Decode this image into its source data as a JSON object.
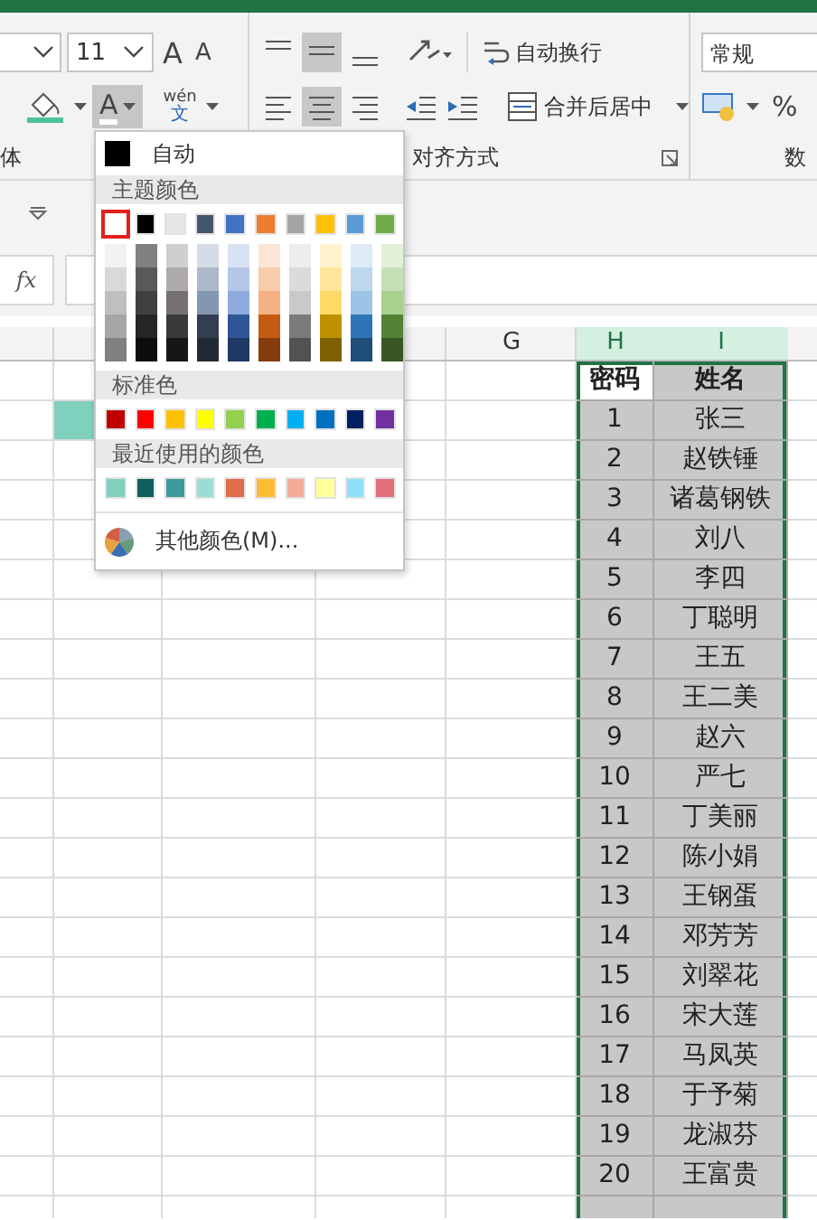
{
  "ribbon": {
    "font_size": "11",
    "grow_font": "A",
    "shrink_font": "A",
    "font_color": {
      "label": "A",
      "pressed": true
    },
    "phonetic": {
      "top": "wén",
      "bottom": "文"
    },
    "wrap_text": "自动换行",
    "merge_center": "合并后居中",
    "number_format": "常规",
    "percent": "%",
    "group_labels": [
      "体",
      "对齐方式",
      "数"
    ]
  },
  "formula_bar": {
    "fx": "fx"
  },
  "color_menu": {
    "auto": "自动",
    "theme_label": "主题颜色",
    "theme": [
      {
        "color": "#ffffff",
        "selected": true,
        "shades": [
          {
            "color": "#f2f2f2",
            "selected": false
          },
          {
            "color": "#d9d9d9",
            "selected": false
          },
          {
            "color": "#bfbfbf",
            "selected": false
          },
          {
            "color": "#a6a6a6",
            "selected": false
          },
          {
            "color": "#808080",
            "selected": false
          }
        ]
      },
      {
        "color": "#000000",
        "selected": false,
        "shades": [
          {
            "color": "#808080",
            "selected": false
          },
          {
            "color": "#595959",
            "selected": false
          },
          {
            "color": "#404040",
            "selected": false
          },
          {
            "color": "#262626",
            "selected": false
          },
          {
            "color": "#0d0d0d",
            "selected": false
          }
        ]
      },
      {
        "color": "#e7e6e6",
        "selected": false,
        "shades": [
          {
            "color": "#d0cece",
            "selected": false
          },
          {
            "color": "#aeaaaa",
            "selected": false
          },
          {
            "color": "#767171",
            "selected": false
          },
          {
            "color": "#3a3838",
            "selected": false
          },
          {
            "color": "#171616",
            "selected": false
          }
        ]
      },
      {
        "color": "#44546a",
        "selected": false,
        "shades": [
          {
            "color": "#d6dce5",
            "selected": false
          },
          {
            "color": "#adb9ca",
            "selected": false
          },
          {
            "color": "#8497b0",
            "selected": false
          },
          {
            "color": "#333f50",
            "selected": false
          },
          {
            "color": "#222a35",
            "selected": false
          }
        ]
      },
      {
        "color": "#4472c4",
        "selected": false,
        "shades": [
          {
            "color": "#dae3f3",
            "selected": false
          },
          {
            "color": "#b4c7e7",
            "selected": false
          },
          {
            "color": "#8faadc",
            "selected": false
          },
          {
            "color": "#2f5597",
            "selected": false
          },
          {
            "color": "#203864",
            "selected": false
          }
        ]
      },
      {
        "color": "#ed7d31",
        "selected": false,
        "shades": [
          {
            "color": "#fbe5d6",
            "selected": false
          },
          {
            "color": "#f8cbad",
            "selected": false
          },
          {
            "color": "#f4b183",
            "selected": false
          },
          {
            "color": "#c55a11",
            "selected": false
          },
          {
            "color": "#843c0c",
            "selected": false
          }
        ]
      },
      {
        "color": "#a5a5a5",
        "selected": false,
        "shades": [
          {
            "color": "#ededed",
            "selected": false
          },
          {
            "color": "#dbdbdb",
            "selected": false
          },
          {
            "color": "#c9c9c9",
            "selected": false
          },
          {
            "color": "#7b7b7b",
            "selected": false
          },
          {
            "color": "#525252",
            "selected": false
          }
        ]
      },
      {
        "color": "#ffc000",
        "selected": false,
        "shades": [
          {
            "color": "#fff2cc",
            "selected": false
          },
          {
            "color": "#ffe699",
            "selected": false
          },
          {
            "color": "#ffd966",
            "selected": false
          },
          {
            "color": "#bf9000",
            "selected": false
          },
          {
            "color": "#7f6000",
            "selected": false
          }
        ]
      },
      {
        "color": "#5b9bd5",
        "selected": false,
        "shades": [
          {
            "color": "#deebf7",
            "selected": false
          },
          {
            "color": "#bdd7ee",
            "selected": false
          },
          {
            "color": "#9dc3e6",
            "selected": false
          },
          {
            "color": "#2e75b6",
            "selected": false
          },
          {
            "color": "#1f4e79",
            "selected": false
          }
        ]
      },
      {
        "color": "#70ad47",
        "selected": false,
        "shades": [
          {
            "color": "#e2f0d9",
            "selected": false
          },
          {
            "color": "#c5e0b4",
            "selected": false
          },
          {
            "color": "#a9d18e",
            "selected": false
          },
          {
            "color": "#548235",
            "selected": false
          },
          {
            "color": "#385723",
            "selected": false
          }
        ]
      }
    ],
    "standard_label": "标准色",
    "standard": [
      {
        "color": "#c00000",
        "selected": false
      },
      {
        "color": "#ff0000",
        "selected": false
      },
      {
        "color": "#ffc000",
        "selected": false
      },
      {
        "color": "#ffff00",
        "selected": false
      },
      {
        "color": "#92d050",
        "selected": false
      },
      {
        "color": "#00b050",
        "selected": false
      },
      {
        "color": "#00b0f0",
        "selected": false
      },
      {
        "color": "#0070c0",
        "selected": false
      },
      {
        "color": "#002060",
        "selected": false
      },
      {
        "color": "#7030a0",
        "selected": false
      }
    ],
    "recent_label": "最近使用的颜色",
    "recent": [
      {
        "color": "#7fd0bd",
        "selected": false
      },
      {
        "color": "#0f5f5f",
        "selected": false
      },
      {
        "color": "#3b9b9b",
        "selected": false
      },
      {
        "color": "#9addd8",
        "selected": false
      },
      {
        "color": "#e06c4c",
        "selected": false
      },
      {
        "color": "#ffba33",
        "selected": false
      },
      {
        "color": "#f4aa99",
        "selected": false
      },
      {
        "color": "#ffff99",
        "selected": false
      },
      {
        "color": "#8de0fb",
        "selected": false
      },
      {
        "color": "#e3707a",
        "selected": false
      }
    ],
    "more": "其他颜色(M)..."
  },
  "sheet": {
    "columns": [
      {
        "label": "G",
        "selected": false
      },
      {
        "label": "H",
        "selected": true
      },
      {
        "label": "I",
        "selected": true
      }
    ],
    "table": {
      "header": [
        "密码",
        "姓名"
      ],
      "rows": [
        [
          "1",
          "张三"
        ],
        [
          "2",
          "赵铁锤"
        ],
        [
          "3",
          "诸葛钢铁"
        ],
        [
          "4",
          "刘八"
        ],
        [
          "5",
          "李四"
        ],
        [
          "6",
          "丁聪明"
        ],
        [
          "7",
          "王五"
        ],
        [
          "8",
          "王二美"
        ],
        [
          "9",
          "赵六"
        ],
        [
          "10",
          "严七"
        ],
        [
          "11",
          "丁美丽"
        ],
        [
          "12",
          "陈小娟"
        ],
        [
          "13",
          "王钢蛋"
        ],
        [
          "14",
          "邓芳芳"
        ],
        [
          "15",
          "刘翠花"
        ],
        [
          "16",
          "宋大莲"
        ],
        [
          "17",
          "马凤英"
        ],
        [
          "18",
          "于予菊"
        ],
        [
          "19",
          "龙淑芬"
        ],
        [
          "20",
          "王富贵"
        ]
      ]
    }
  }
}
